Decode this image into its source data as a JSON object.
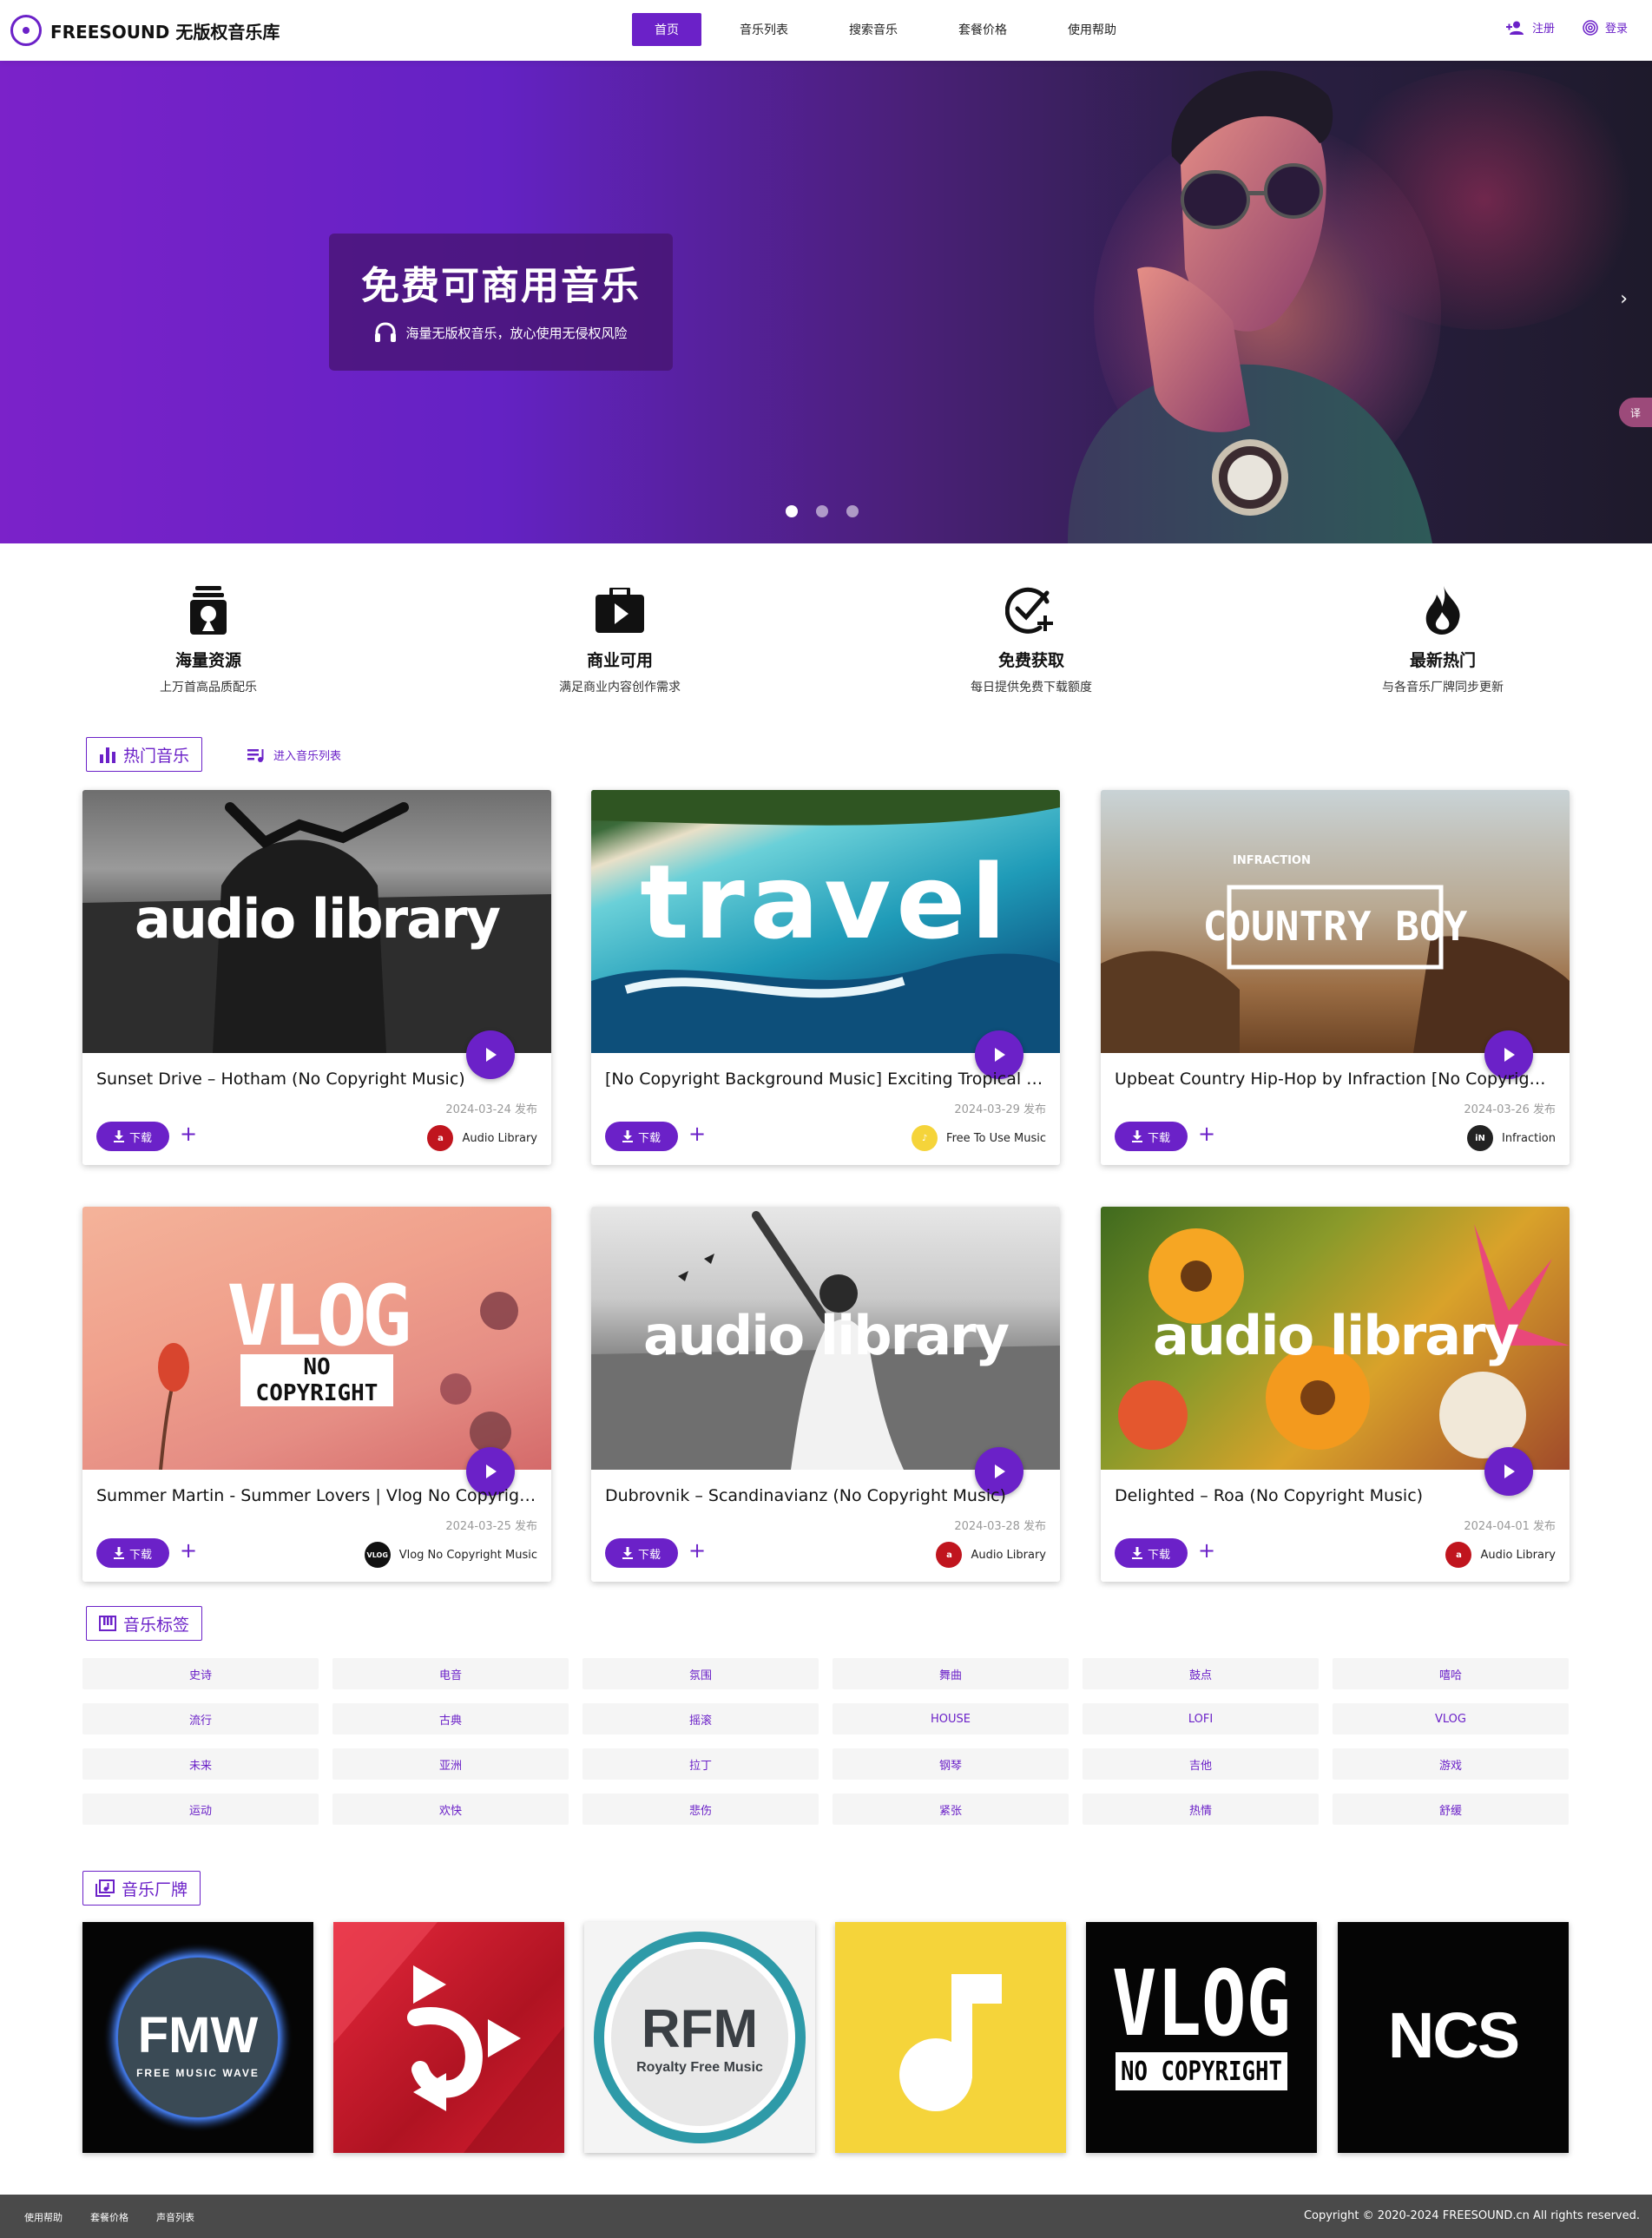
{
  "header": {
    "logo_text": "FREESOUND 无版权音乐库",
    "nav": [
      "首页",
      "音乐列表",
      "搜索音乐",
      "套餐价格",
      "使用帮助"
    ],
    "register": "注册",
    "login": "登录"
  },
  "hero": {
    "title": "免费可商用音乐",
    "subtitle": "海量无版权音乐，放心使用无侵权风险",
    "side_tab": "译"
  },
  "features": [
    {
      "title": "海量资源",
      "desc": "上万首高品质配乐"
    },
    {
      "title": "商业可用",
      "desc": "满足商业内容创作需求"
    },
    {
      "title": "免费获取",
      "desc": "每日提供免费下载额度"
    },
    {
      "title": "最新热门",
      "desc": "与各音乐厂牌同步更新"
    }
  ],
  "hot_music": {
    "heading": "热门音乐",
    "link": "进入音乐列表",
    "download_label": "下载",
    "cards": [
      {
        "title": "Sunset Drive – Hotham (No Copyright Music)",
        "date": "2024-03-24 发布",
        "artist": "Audio Library",
        "cover_text": "audio library"
      },
      {
        "title": "[No Copyright Background Music] Exciting Tropical Tr...",
        "date": "2024-03-29 发布",
        "artist": "Free To Use Music",
        "cover_text": "travel"
      },
      {
        "title": "Upbeat Country Hip-Hop by Infraction [No Copyright ...",
        "date": "2024-03-26 发布",
        "artist": "Infraction",
        "cover_text": "COUNTRY BOY"
      },
      {
        "title": "Summer Martin - Summer Lovers | Vlog No Copyright...",
        "date": "2024-03-25 发布",
        "artist": "Vlog No Copyright Music",
        "cover_text": "VLOG"
      },
      {
        "title": "Dubrovnik – Scandinavianz (No Copyright Music)",
        "date": "2024-03-28 发布",
        "artist": "Audio Library",
        "cover_text": "audio library"
      },
      {
        "title": "Delighted – Roa (No Copyright Music)",
        "date": "2024-04-01 发布",
        "artist": "Audio Library",
        "cover_text": "audio library"
      }
    ]
  },
  "tags": {
    "heading": "音乐标签",
    "items": [
      "史诗",
      "电音",
      "氛围",
      "舞曲",
      "鼓点",
      "嘻哈",
      "流行",
      "古典",
      "摇滚",
      "HOUSE",
      "LOFI",
      "VLOG",
      "未来",
      "亚洲",
      "拉丁",
      "钢琴",
      "吉他",
      "游戏",
      "运动",
      "欢快",
      "悲伤",
      "紧张",
      "热情",
      "舒缓"
    ]
  },
  "labels": {
    "heading": "音乐厂牌"
  },
  "footer": {
    "links": [
      "使用帮助",
      "套餐价格",
      "声音列表"
    ],
    "copyright": "Copyright © 2020-2024 FREESOUND.cn All rights reserved."
  },
  "colors": {
    "accent": "#6b21c8",
    "footer_bg": "#4a4a4a",
    "tag_bg": "#f5f5f5"
  }
}
